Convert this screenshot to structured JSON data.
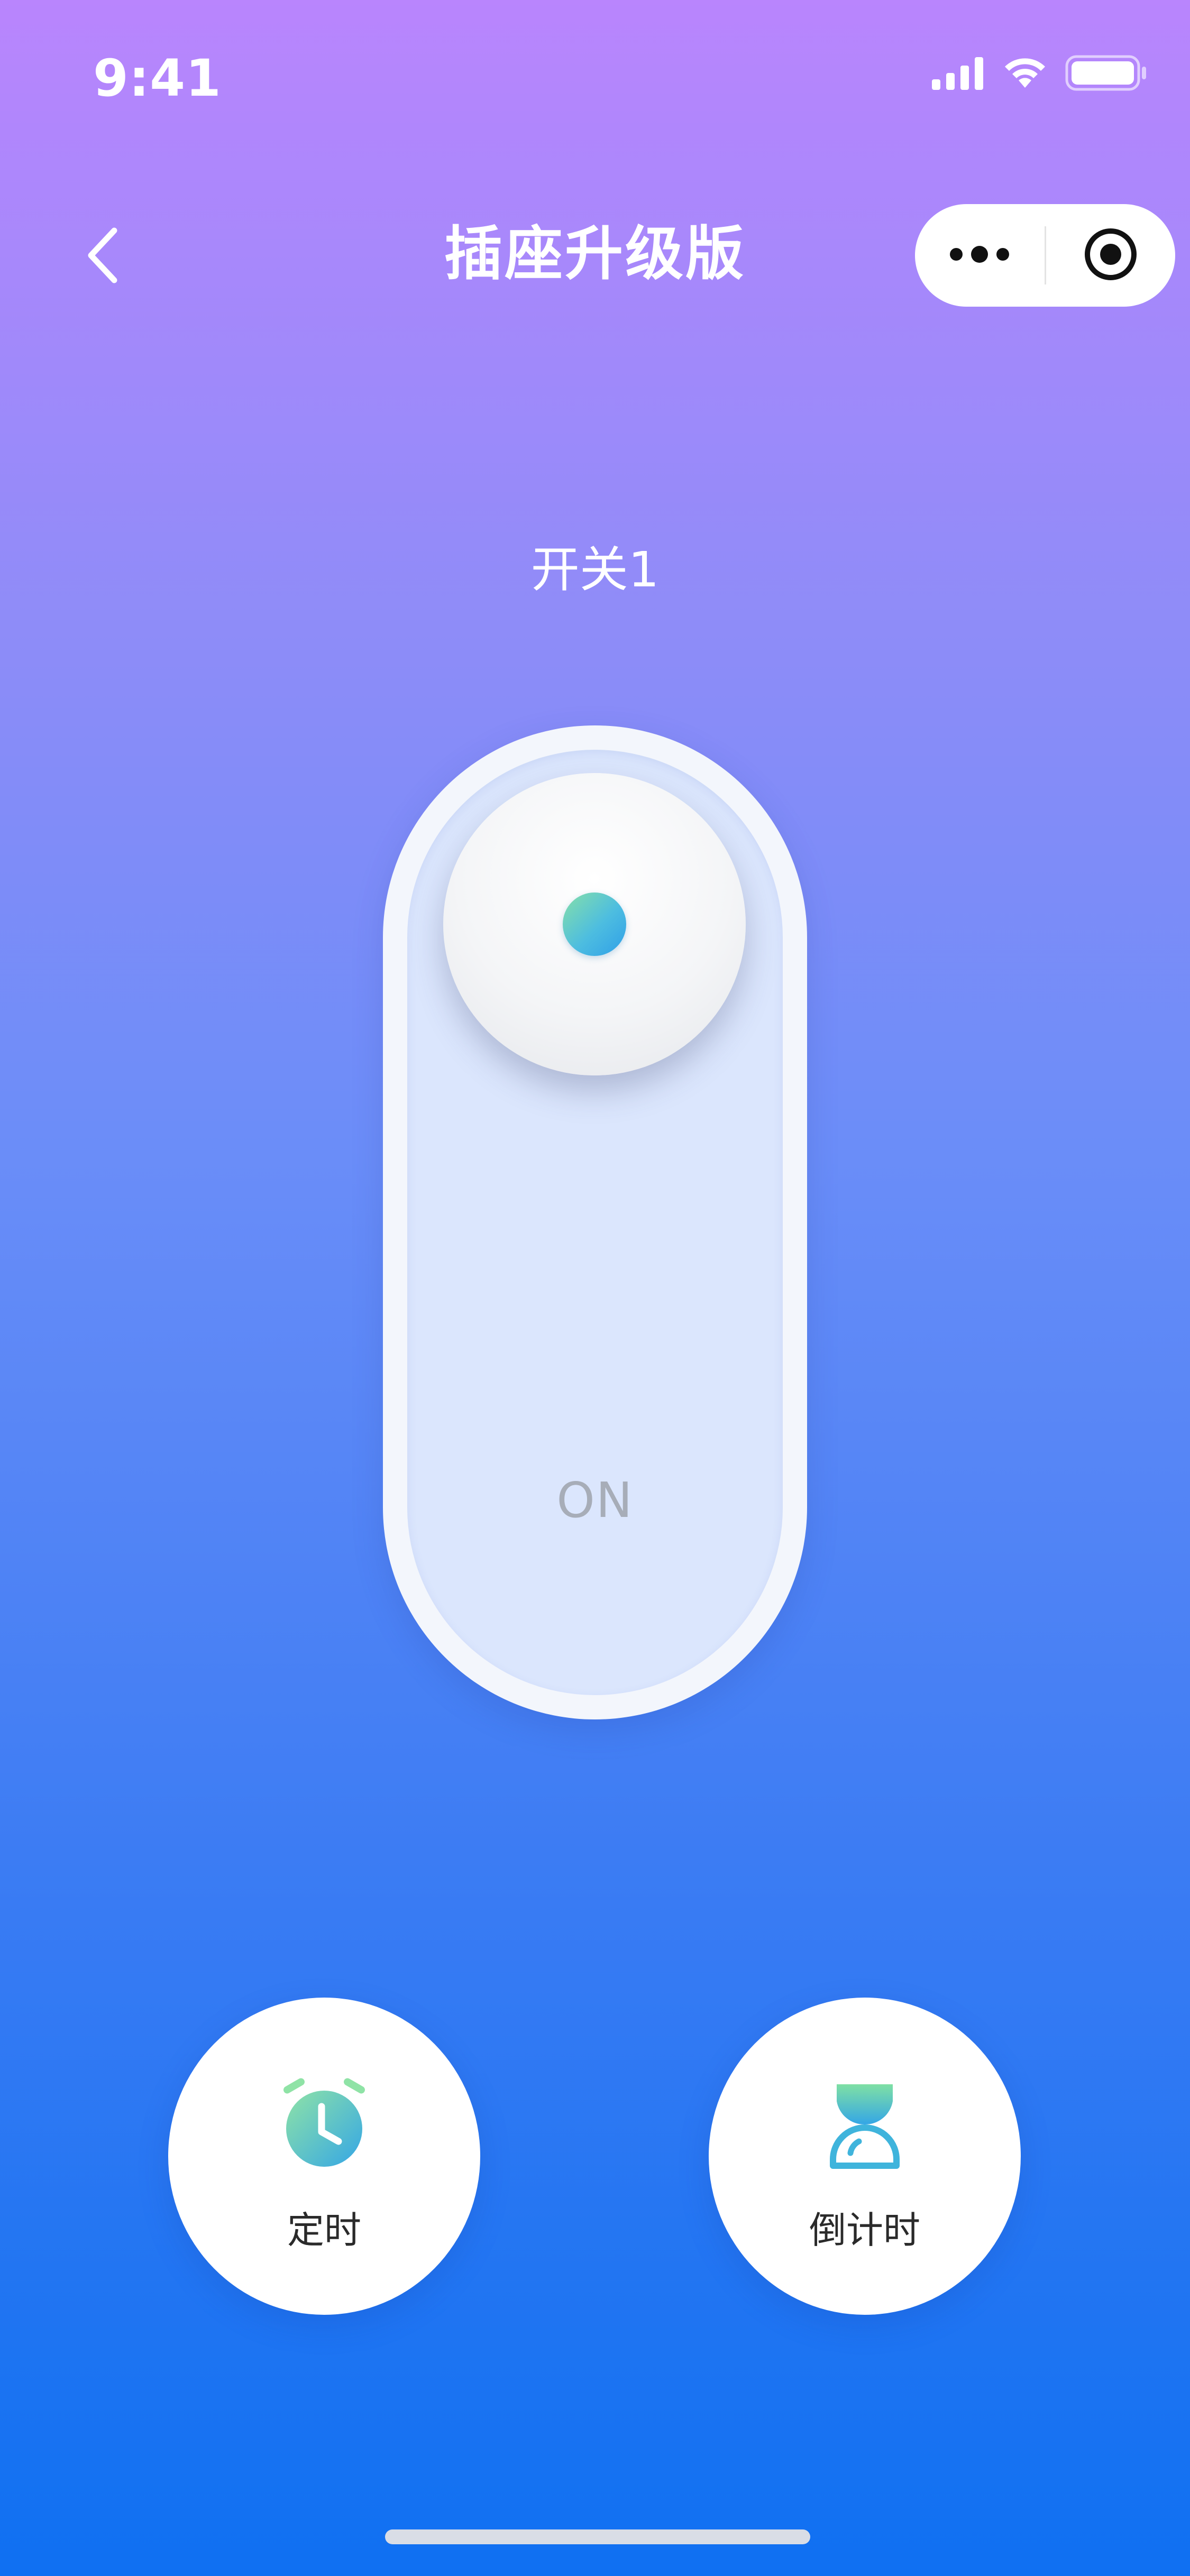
{
  "status_bar": {
    "time": "9:41",
    "icons": [
      "cellular-signal-icon",
      "wifi-icon",
      "battery-icon"
    ]
  },
  "nav": {
    "back_icon": "chevron-left-icon",
    "title": "插座升级版",
    "capsule": {
      "more_icon": "more-dots-icon",
      "close_icon": "record-close-icon"
    }
  },
  "switch": {
    "label": "开关1",
    "state_text": "ON",
    "is_on": true
  },
  "actions": [
    {
      "label": "定时",
      "icon": "alarm-clock-icon"
    },
    {
      "label": "倒计时",
      "icon": "hourglass-icon"
    }
  ],
  "colors": {
    "gradient_top": "#b985fd",
    "gradient_bottom": "#0f70f2",
    "accent_green": "#86e0a8",
    "accent_blue": "#2f9fe8",
    "toggle_track": "#dbe6fd"
  }
}
